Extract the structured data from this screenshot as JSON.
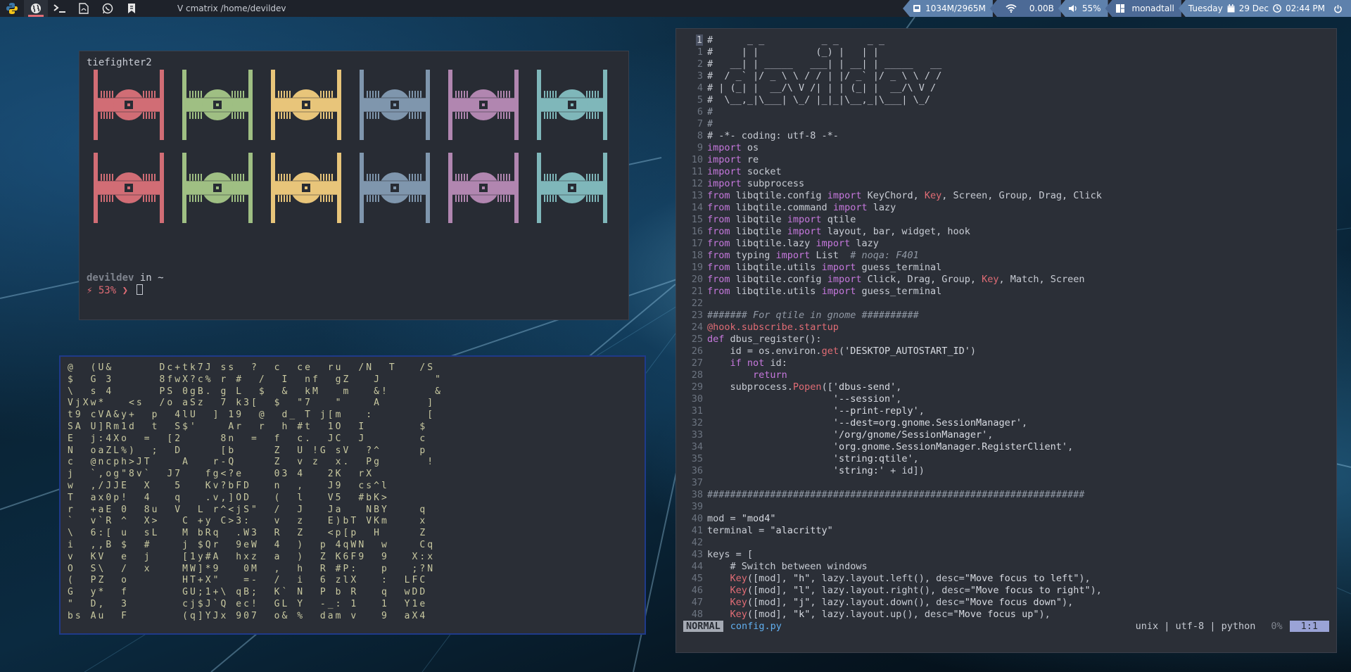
{
  "topbar": {
    "groups": [
      {
        "icon": "python-icon"
      },
      {
        "icon": "globe-icon",
        "active": true
      },
      {
        "icon": "terminal-icon"
      },
      {
        "icon": "pdf-icon"
      },
      {
        "icon": "whatsapp-icon"
      },
      {
        "icon": "bookmark-icon"
      }
    ],
    "window_title": "V cmatrix /home/devildev",
    "memory": "1034M/2965M",
    "net": "0.00B",
    "volume": "55%",
    "layout": "monadtall",
    "date": "Tuesday",
    "date2": "29 Dec",
    "time": "02:44 PM",
    "colors": {
      "widget_a": "#5e81ac",
      "widget_b": "#4c6a96"
    }
  },
  "tiefighter": {
    "title": "tiefighter2",
    "colors": [
      "#d16d75",
      "#9fbf83",
      "#e8c57a",
      "#7f96ad",
      "#b186b0",
      "#7fb7ba"
    ],
    "prompt_user": "devildev",
    "prompt_in": " in ~",
    "prompt_bolt": "⚡ 53% ❯ "
  },
  "cmatrix": {
    "lines": [
      "@  (U&      Dc+tk7J ss  ?  c  ce  ru  /N  T   /S",
      "$  G 3      8fwX?c% r #  /  I  nf  gZ   J       \"",
      "\\  s 4      PS 0gB. g L  $  &  kM   m   &!      &",
      "VjXw*   <s  /o aSz  7 k3[  $  \"7   \"    A      ]",
      "t9 cVA&y+  p  4lU  ] 19  @  d_ T j[m   :       [",
      "SA U]Rm1d  t  S$'    Ar  r  h #t  1O  I       $",
      "E  j:4Xo  =  [2     8n  =  f  c.  JC  J       c",
      "N  oaZL%)  ;  D     [b     Z  U !G sV  ?^     p",
      "c  @ncph>JT    A   r-Q     Z  v z  x.  Pg      !",
      "j  `,og\"8v`  J7   fg<?e    03 4   2K  rX       ",
      "w  ,/JJE  X   5   Kv?bFD   n  ,   J9  cs^l     ",
      "T  ax0p!  4   q   .v,]OD   (  l   V5  #bK>     ",
      "r  +aE 0  8u  V  L r^<jS\"  /  J   Ja   NBY    q",
      "`  v`R ^  X>   C +y C>3:   v  z   E)bT VKm    x",
      "\\  6:[ u  sL   M bRq  .W3  R  Z   <p[p  H     Z",
      "i  ,,B $  #    j $Qr  9eW  4  )  p 4qWN  w    Cq",
      "v  KV  e  j    [1y#A  hxz  a  )  Z K6F9  9   X:x",
      "O  S\\  /  x    MW]*9   0M  ,  h  R #P:   p   ;?N",
      "(  PZ  o       HT+X\"   =-  /  i  6 zlX   :  LFC",
      "G  y*  f       GU;1+\\ qB;  K` N  P b R   q  wDD",
      "\"  D,  3       cj$J`Q ec!  GL Y  -_: 1   1  Y1e",
      "bs Au  F       (q]YJx 907  o& %  dam v   9  aX4"
    ]
  },
  "vim": {
    "lines": [
      {
        "n": "1",
        "t": "#      _ _          _ _     _ _"
      },
      {
        "n": "1",
        "t": "#     | |          (_) |   | |"
      },
      {
        "n": "2",
        "t": "#   __| | _____   ___| | __| | _____   __"
      },
      {
        "n": "3",
        "t": "#  / _` |/ _ \\ \\ / / | |/ _` |/ _ \\ \\ / /"
      },
      {
        "n": "4",
        "t": "# | (_| |  __/\\ V /| | | (_| |  __/\\ V /"
      },
      {
        "n": "5",
        "t": "#  \\__,_|\\___| \\_/ |_|_|\\__,_|\\___| \\_/"
      },
      {
        "n": "6",
        "t": "#"
      },
      {
        "n": "7",
        "t": "#"
      },
      {
        "n": "8",
        "t": "# -*- coding: utf-8 -*-"
      },
      {
        "n": "9",
        "t": "import os"
      },
      {
        "n": "10",
        "t": "import re"
      },
      {
        "n": "11",
        "t": "import socket"
      },
      {
        "n": "12",
        "t": "import subprocess"
      },
      {
        "n": "13",
        "t": "from libqtile.config import KeyChord, Key, Screen, Group, Drag, Click"
      },
      {
        "n": "14",
        "t": "from libqtile.command import lazy"
      },
      {
        "n": "15",
        "t": "from libqtile import qtile"
      },
      {
        "n": "16",
        "t": "from libqtile import layout, bar, widget, hook"
      },
      {
        "n": "17",
        "t": "from libqtile.lazy import lazy"
      },
      {
        "n": "18",
        "t": "from typing import List  # noqa: F401"
      },
      {
        "n": "19",
        "t": "from libqtile.utils import guess_terminal"
      },
      {
        "n": "20",
        "t": "from libqtile.config import Click, Drag, Group, Key, Match, Screen"
      },
      {
        "n": "21",
        "t": "from libqtile.utils import guess_terminal"
      },
      {
        "n": "22",
        "t": ""
      },
      {
        "n": "23",
        "t": "####### For qtile in gnome ##########"
      },
      {
        "n": "24",
        "t": "@hook.subscribe.startup"
      },
      {
        "n": "25",
        "t": "def dbus_register():"
      },
      {
        "n": "26",
        "t": "    id = os.environ.get('DESKTOP_AUTOSTART_ID')"
      },
      {
        "n": "27",
        "t": "    if not id:"
      },
      {
        "n": "28",
        "t": "        return"
      },
      {
        "n": "29",
        "t": "    subprocess.Popen(['dbus-send',"
      },
      {
        "n": "30",
        "t": "                      '--session',"
      },
      {
        "n": "31",
        "t": "                      '--print-reply',"
      },
      {
        "n": "32",
        "t": "                      '--dest=org.gnome.SessionManager',"
      },
      {
        "n": "33",
        "t": "                      '/org/gnome/SessionManager',"
      },
      {
        "n": "34",
        "t": "                      'org.gnome.SessionManager.RegisterClient',"
      },
      {
        "n": "35",
        "t": "                      'string:qtile',"
      },
      {
        "n": "36",
        "t": "                      'string:' + id])"
      },
      {
        "n": "37",
        "t": ""
      },
      {
        "n": "38",
        "t": "##################################################################"
      },
      {
        "n": "39",
        "t": ""
      },
      {
        "n": "40",
        "t": "mod = \"mod4\""
      },
      {
        "n": "41",
        "t": "terminal = \"alacritty\""
      },
      {
        "n": "42",
        "t": ""
      },
      {
        "n": "43",
        "t": "keys = ["
      },
      {
        "n": "44",
        "t": "    # Switch between windows"
      },
      {
        "n": "45",
        "t": "    Key([mod], \"h\", lazy.layout.left(), desc=\"Move focus to left\"),"
      },
      {
        "n": "46",
        "t": "    Key([mod], \"l\", lazy.layout.right(), desc=\"Move focus to right\"),"
      },
      {
        "n": "47",
        "t": "    Key([mod], \"j\", lazy.layout.down(), desc=\"Move focus down\"),"
      },
      {
        "n": "48",
        "t": "    Key([mod], \"k\", lazy.layout.up(), desc=\"Move focus up\"),"
      }
    ],
    "mode": "NORMAL",
    "filename": "config.py",
    "encoding": "unix | utf-8 | python",
    "percent": "0%",
    "position": "1:1"
  }
}
